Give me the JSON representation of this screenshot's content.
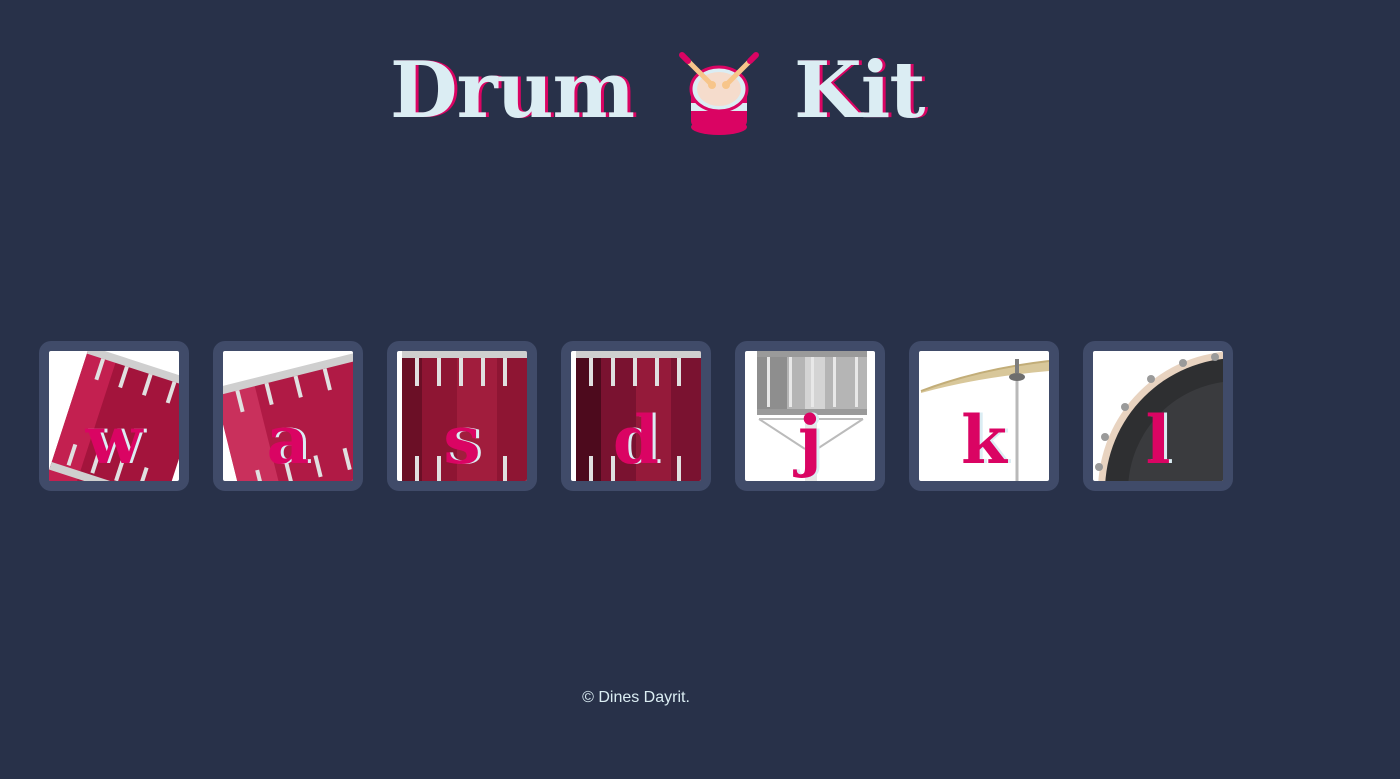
{
  "header": {
    "title_left": "Drum",
    "title_right": "Kit",
    "icon": "drum-icon"
  },
  "drums": [
    {
      "key": "w",
      "instrument": "tom-1"
    },
    {
      "key": "a",
      "instrument": "tom-2"
    },
    {
      "key": "s",
      "instrument": "tom-3"
    },
    {
      "key": "d",
      "instrument": "tom-4"
    },
    {
      "key": "j",
      "instrument": "snare"
    },
    {
      "key": "k",
      "instrument": "crash"
    },
    {
      "key": "l",
      "instrument": "kick"
    }
  ],
  "footer": {
    "text": "© Dines Dayrit."
  },
  "colors": {
    "background": "#283149",
    "button_border": "#404b69",
    "accent": "#da0463",
    "text_light": "#dbedf3"
  }
}
